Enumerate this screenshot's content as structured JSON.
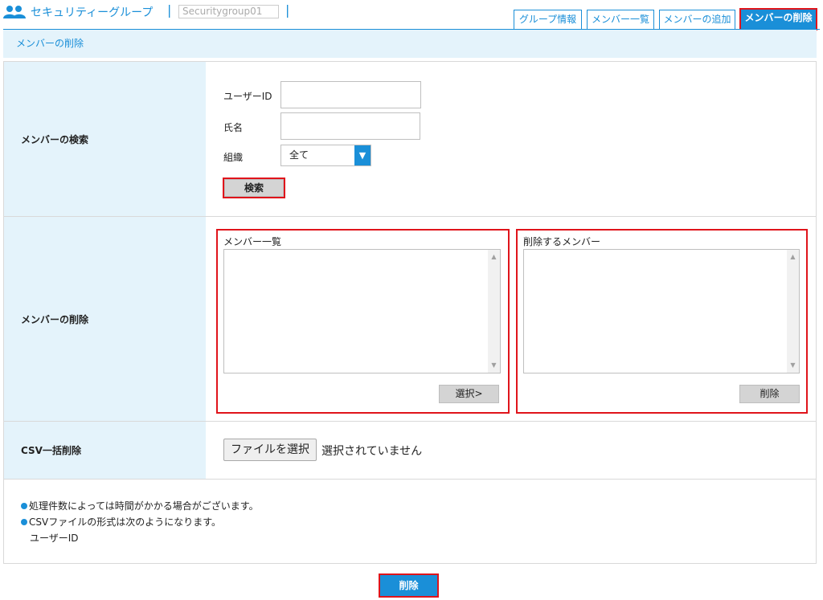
{
  "header": {
    "icon": "group-users-icon",
    "title": "セキュリティーグループ",
    "separator": "|",
    "group_name": "Securitygroup01",
    "tabs": [
      {
        "label": "グループ情報",
        "active": false
      },
      {
        "label": "メンバー一覧",
        "active": false
      },
      {
        "label": "メンバーの追加",
        "active": false
      },
      {
        "label": "メンバーの削除",
        "active": true
      }
    ]
  },
  "page_subtitle": "メンバーの削除",
  "search_section": {
    "label": "メンバーの検索",
    "user_id_label": "ユーザーID",
    "user_id_value": "",
    "name_label": "氏名",
    "name_value": "",
    "org_label": "組織",
    "org_selected": "全て",
    "search_button": "検索"
  },
  "delete_section": {
    "label": "メンバーの削除",
    "member_list_title": "メンバー一覧",
    "select_button": "選択>",
    "delete_list_title": "削除するメンバー",
    "delete_button": "削除"
  },
  "csv_section": {
    "label": "CSV一括削除",
    "file_button": "ファイルを選択",
    "file_status": "選択されていません"
  },
  "notes": [
    "処理件数によっては時間がかかる場合がございます。",
    "CSVファイルの形式は次のようになります。"
  ],
  "csv_format_example": "ユーザーID",
  "submit_button": "削除",
  "colors": {
    "accent": "#1a8fd8",
    "highlight_outline": "#e0141b",
    "label_background": "#e4f3fb"
  }
}
